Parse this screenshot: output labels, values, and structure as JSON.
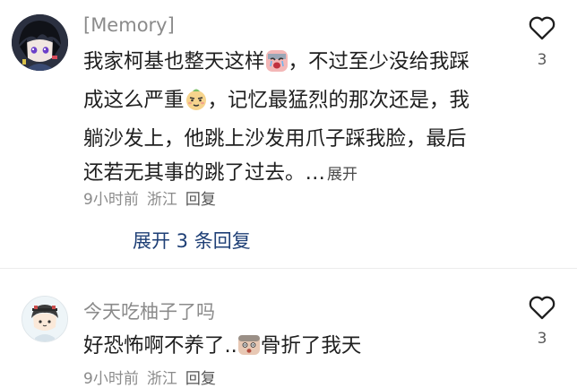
{
  "comments": [
    {
      "username": "[Memory]",
      "text_part1": "我家柯基也整天这样",
      "text_part2": "，不过至少没给我踩成这么严重",
      "text_part3": "，记忆最猛烈的那次还是，我躺沙发上，他跳上沙发用爪子踩我脸，最后还若无其事的跳了过去。…",
      "expand_label": "展开",
      "time": "9小时前",
      "location": "浙江",
      "reply_label": "回复",
      "like_count": "3",
      "more_replies_label": "展开 3 条回复"
    },
    {
      "username": "今天吃柚子了吗",
      "text_part1": "好恐怖啊不养了..",
      "text_part2": "骨折了我天",
      "time": "9小时前",
      "location": "浙江",
      "reply_label": "回复",
      "like_count": "3"
    }
  ],
  "icons": {
    "like": "heart-outline-icon",
    "emoji_1": "crying-face-emoji",
    "emoji_2": "smirk-face-emoji",
    "emoji_3": "stunned-face-emoji"
  },
  "colors": {
    "text": "#1f1f1f",
    "muted": "#8b8b8b",
    "link": "#1e3f76"
  }
}
